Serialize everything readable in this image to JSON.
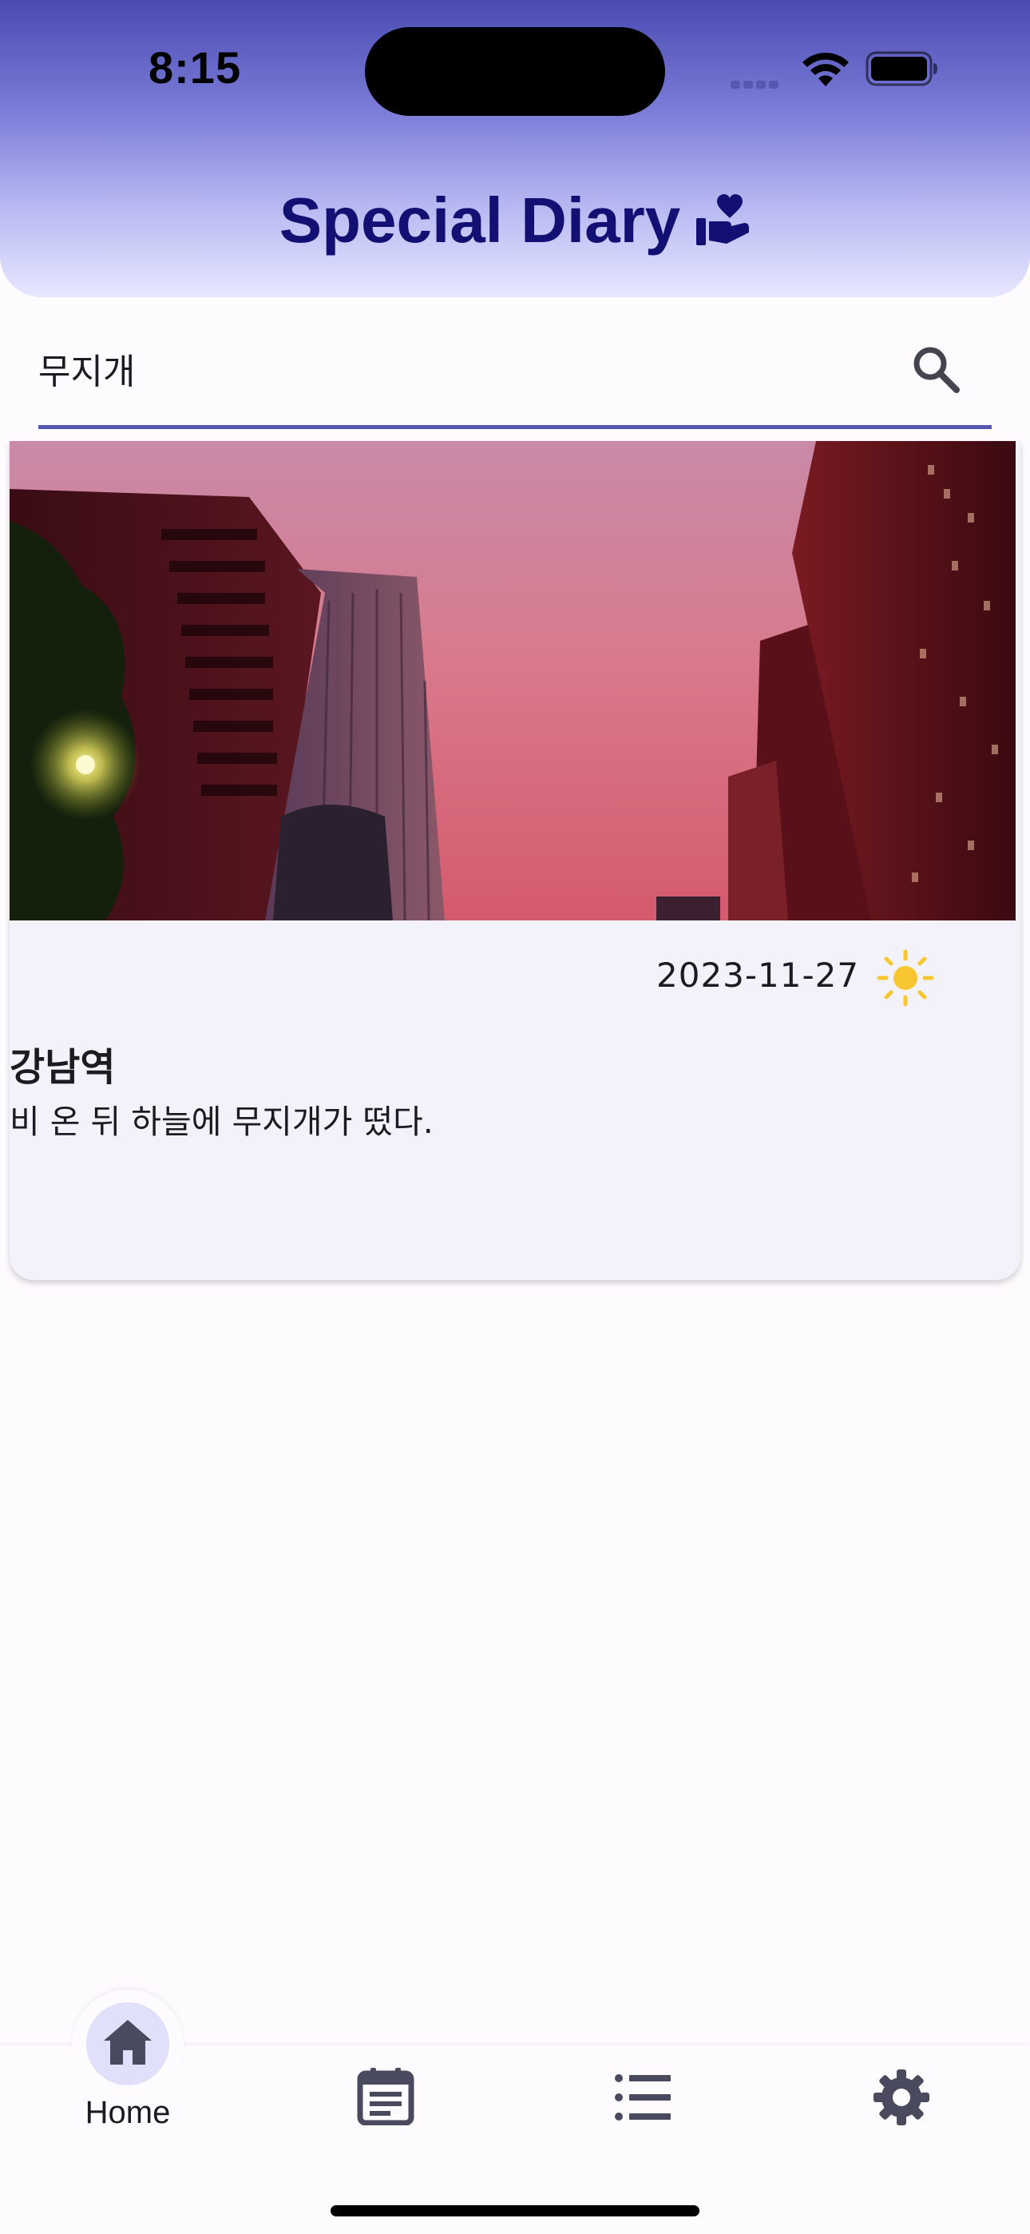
{
  "status_bar": {
    "time": "8:15"
  },
  "header": {
    "title": "Special Diary",
    "title_icon": "volunteer-activism-icon",
    "gradient_top": "#4a4bb2",
    "gradient_bottom": "#e7e7ff",
    "title_color": "#131074"
  },
  "search": {
    "value": "무지개",
    "icon": "search-icon",
    "underline_color": "#5557b3"
  },
  "entries": [
    {
      "date": "2023-11-27",
      "weather_icon": "sun-icon",
      "title": "강남역",
      "body": "비 온 뒤 하늘에 무지개가 떴다."
    }
  ],
  "bottom_nav": {
    "items": [
      {
        "label": "Home",
        "icon": "home-icon",
        "selected": true
      },
      {
        "label": "",
        "icon": "calendar-note-icon",
        "selected": false
      },
      {
        "label": "",
        "icon": "list-icon",
        "selected": false
      },
      {
        "label": "",
        "icon": "gear-icon",
        "selected": false
      }
    ]
  }
}
